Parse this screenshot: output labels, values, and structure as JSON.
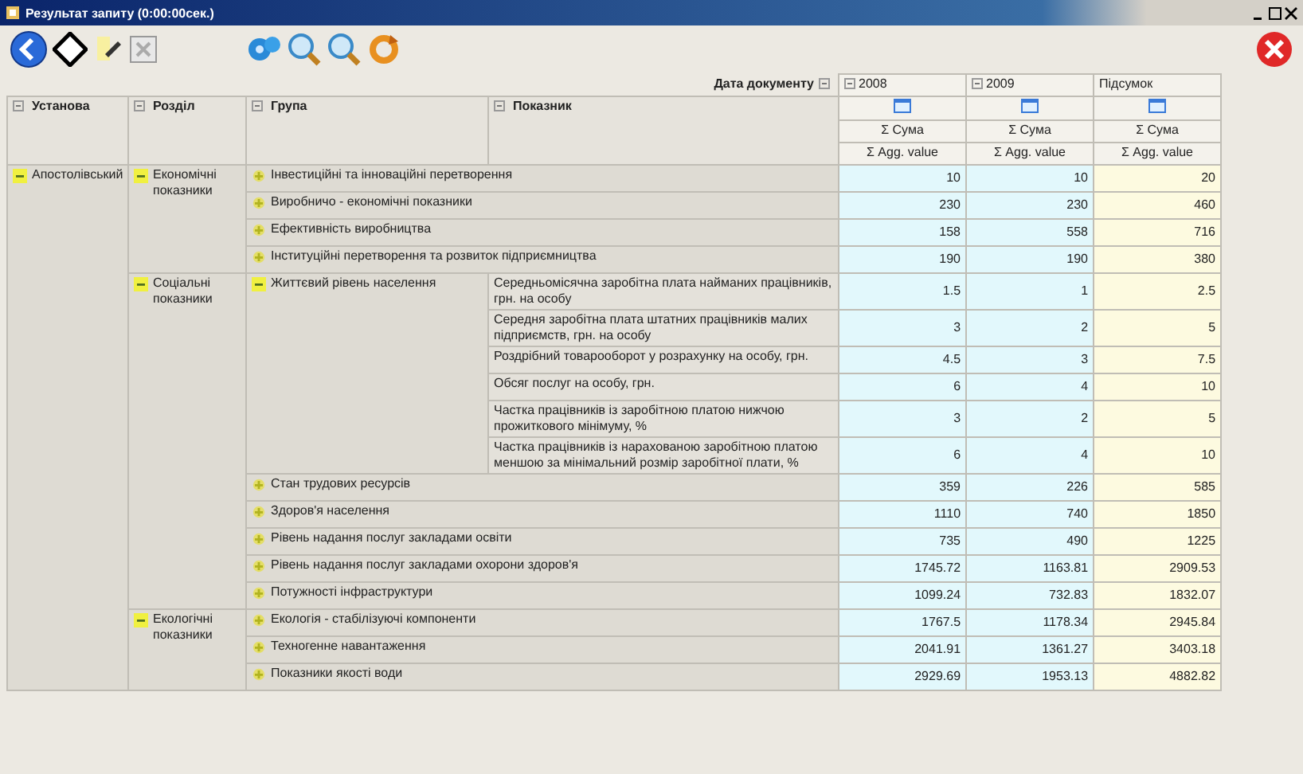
{
  "window": {
    "title": "Результат запиту (0:00:00сек.)"
  },
  "column_field": {
    "label": "Дата документу"
  },
  "columns": [
    {
      "label": "2008",
      "kind": "year",
      "measures": [
        "Σ Сума",
        "Σ Agg. value"
      ]
    },
    {
      "label": "2009",
      "kind": "year",
      "measures": [
        "Σ Сума",
        "Σ Agg. value"
      ]
    },
    {
      "label": "Підсумок",
      "kind": "total",
      "measures": [
        "Σ Сума",
        "Σ Agg. value"
      ]
    }
  ],
  "row_fields": [
    "Установа",
    "Розділ",
    "Група",
    "Показник"
  ],
  "units": [
    {
      "name": "Апостолівський",
      "expanded": true,
      "sections": [
        {
          "name": "Економічні показники",
          "expanded": true,
          "groups": [
            {
              "name": "Інвестиційні та інноваційні перетворення",
              "expanded": false,
              "values": [
                "10",
                "10",
                "20"
              ]
            },
            {
              "name": "Виробничо - економічні показники",
              "expanded": false,
              "values": [
                "230",
                "230",
                "460"
              ]
            },
            {
              "name": "Ефективність виробництва",
              "expanded": false,
              "values": [
                "158",
                "558",
                "716"
              ]
            },
            {
              "name": "Інституційні перетворення та розвиток підприємництва",
              "expanded": false,
              "values": [
                "190",
                "190",
                "380"
              ]
            }
          ]
        },
        {
          "name": "Соціальні показники",
          "expanded": true,
          "groups": [
            {
              "name": "Життєвий рівень населення",
              "expanded": true,
              "indicators": [
                {
                  "name": "Середньомісячна заробітна плата найманих працівників, грн. на особу",
                  "values": [
                    "1.5",
                    "1",
                    "2.5"
                  ]
                },
                {
                  "name": "Середня заробітна плата штатних працівників малих підприємств, грн. на особу",
                  "values": [
                    "3",
                    "2",
                    "5"
                  ]
                },
                {
                  "name": "Роздрібний товарооборот у розрахунку на особу, грн.",
                  "values": [
                    "4.5",
                    "3",
                    "7.5"
                  ]
                },
                {
                  "name": "Обсяг послуг на особу, грн.",
                  "values": [
                    "6",
                    "4",
                    "10"
                  ]
                },
                {
                  "name": "Частка працівників із заробітною платою нижчою прожиткового мінімуму, %",
                  "values": [
                    "3",
                    "2",
                    "5"
                  ]
                },
                {
                  "name": "Частка працівників із нарахованою заробітною платою меншою за мінімальний розмір заробітної плати, %",
                  "values": [
                    "6",
                    "4",
                    "10"
                  ]
                }
              ]
            },
            {
              "name": "Стан трудових ресурсів",
              "expanded": false,
              "values": [
                "359",
                "226",
                "585"
              ]
            },
            {
              "name": "Здоров'я населення",
              "expanded": false,
              "values": [
                "1110",
                "740",
                "1850"
              ]
            },
            {
              "name": "Рівень надання послуг закладами освіти",
              "expanded": false,
              "values": [
                "735",
                "490",
                "1225"
              ]
            },
            {
              "name": "Рівень надання послуг закладами охорони здоров'я",
              "expanded": false,
              "values": [
                "1745.72",
                "1163.81",
                "2909.53"
              ]
            },
            {
              "name": "Потужності інфраструктури",
              "expanded": false,
              "values": [
                "1099.24",
                "732.83",
                "1832.07"
              ]
            }
          ]
        },
        {
          "name": "Екологічні показники",
          "expanded": true,
          "groups": [
            {
              "name": "Екологія - стабілізуючі компоненти",
              "expanded": false,
              "values": [
                "1767.5",
                "1178.34",
                "2945.84"
              ]
            },
            {
              "name": "Техногенне навантаження",
              "expanded": false,
              "values": [
                "2041.91",
                "1361.27",
                "3403.18"
              ]
            },
            {
              "name": "Показники якості води",
              "expanded": false,
              "values": [
                "2929.69",
                "1953.13",
                "4882.82"
              ]
            }
          ]
        }
      ]
    }
  ]
}
